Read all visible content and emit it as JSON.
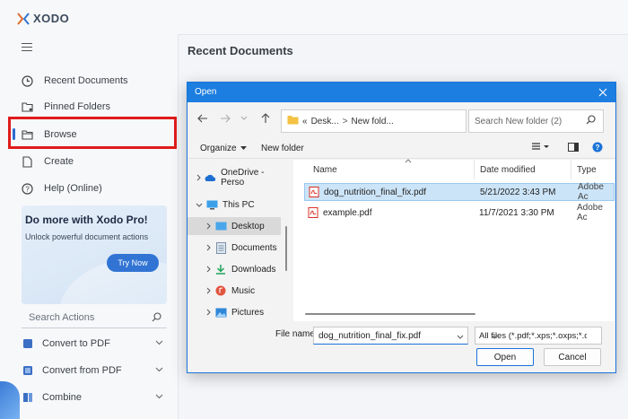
{
  "app": {
    "logo_text": "XODO",
    "main_title": "Recent Documents"
  },
  "sidebar": {
    "items": [
      {
        "label": "Recent Documents",
        "icon": "clock-icon"
      },
      {
        "label": "Pinned Folders",
        "icon": "pinned-folder-icon"
      },
      {
        "label": "Browse",
        "icon": "folder-open-icon"
      },
      {
        "label": "Create",
        "icon": "create-document-icon"
      },
      {
        "label": "Help (Online)",
        "icon": "help-icon"
      }
    ],
    "promo": {
      "title": "Do more with Xodo Pro!",
      "subtitle": "Unlock powerful document actions",
      "button": "Try Now"
    },
    "search_placeholder": "Search Actions",
    "tools": [
      {
        "label": "Convert to PDF"
      },
      {
        "label": "Convert from PDF"
      },
      {
        "label": "Combine"
      }
    ]
  },
  "dialog": {
    "title": "Open",
    "address": {
      "prefix": "«",
      "crumb1": "Desk...",
      "separator": ">",
      "crumb2": "New fold..."
    },
    "search_placeholder": "Search New folder (2)",
    "toolbar": {
      "organize": "Organize",
      "new_folder": "New folder"
    },
    "tree": [
      {
        "label": "OneDrive - Perso",
        "icon": "onedrive-cloud-icon"
      },
      {
        "label": "This PC",
        "icon": "computer-icon"
      },
      {
        "label": "Desktop",
        "icon": "desktop-icon"
      },
      {
        "label": "Documents",
        "icon": "documents-icon"
      },
      {
        "label": "Downloads",
        "icon": "downloads-icon"
      },
      {
        "label": "Music",
        "icon": "music-icon"
      },
      {
        "label": "Pictures",
        "icon": "pictures-icon"
      }
    ],
    "columns": {
      "name": "Name",
      "date": "Date modified",
      "type": "Type"
    },
    "files": [
      {
        "name": "dog_nutrition_final_fix.pdf",
        "date": "5/21/2022 3:43 PM",
        "type": "Adobe Ac"
      },
      {
        "name": "example.pdf",
        "date": "11/7/2021 3:30 PM",
        "type": "Adobe Ac"
      }
    ],
    "file_name_label": "File name:",
    "file_name_value": "dog_nutrition_final_fix.pdf",
    "file_type_value": "All files (*.pdf;*.xps;*.oxps;*.doc",
    "open_button": "Open",
    "cancel_button": "Cancel"
  },
  "colors": {
    "accent": "#1c7ee0",
    "highlight": "#e01b1b",
    "selection": "#cce4f7"
  }
}
